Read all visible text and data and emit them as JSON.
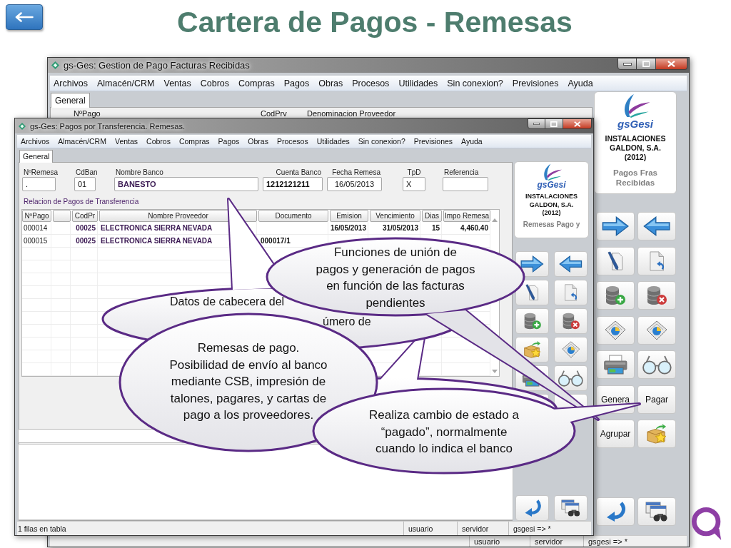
{
  "slide": {
    "title": "Cartera de Pagos - Remesas"
  },
  "back_window": {
    "title": "gs-Ges: Gestion de Pago Facturas Recibidas",
    "menu": [
      "Archivos",
      "Almacén/CRM",
      "Ventas",
      "Cobros",
      "Compras",
      "Pagos",
      "Obras",
      "Procesos",
      "Utilidades",
      "Sin conexion?",
      "Previsiones",
      "Ayuda"
    ],
    "tabs": [
      {
        "label": "General",
        "selected": true
      }
    ],
    "header_labels": [
      "NºPago",
      "CodPrv",
      "Denominacion Proveedor"
    ],
    "side_panel": {
      "brand": "gsGesi",
      "company": [
        "INSTALACIONES",
        "GALDON, S.A.",
        "(2012)"
      ],
      "module": "Pagos Fras Recibidas",
      "buttons": [
        "Genera",
        "Pagar",
        "Agrupar"
      ]
    },
    "status_bar": [
      "usuario",
      "servidor",
      "gsgesi => *"
    ]
  },
  "front_window": {
    "title": "gs-Ges: Pagos por Transferencia. Remesas.",
    "menu": [
      "Archivos",
      "Almacén/CRM",
      "Ventas",
      "Cobros",
      "Compras",
      "Pagos",
      "Obras",
      "Procesos",
      "Utilidades",
      "Sin conexion?",
      "Previsiones",
      "Ayuda"
    ],
    "tabs": [
      {
        "label": "General",
        "selected": true
      }
    ],
    "fields": [
      {
        "label": "NºRemesa",
        "value": "."
      },
      {
        "label": "CdBan",
        "value": "01"
      },
      {
        "label": "Nombre Banco",
        "value": "BANESTO"
      },
      {
        "label": "Cuenta Banco",
        "value": "1212121211"
      },
      {
        "label": "Fecha Remesa",
        "value": "16/05/2013"
      },
      {
        "label": "TpD",
        "value": "X"
      },
      {
        "label": "Referencia"
      }
    ],
    "section_title": "Relacion de Pagos de Transferencia",
    "table": {
      "columns": {
        "n_pago": "NºPago",
        "cod_pr": "CodPr",
        "nombre_proveedor": "Nombre Proveedor",
        "documento": "Documento",
        "emision": "Emision",
        "vencimiento": "Vencimiento",
        "dias": "Dias",
        "impo_remesa": "Impo Remesa"
      },
      "rows": [
        {
          "n_pago": "000014",
          "cod_pr": "00025",
          "nombre_proveedor": "ELECTRONICA SIERRA NEVADA",
          "emision": "16/05/2013",
          "vencimiento": "31/05/2013",
          "dias": "15",
          "impo_remesa": "4,460.40"
        },
        {
          "n_pago": "000015",
          "cod_pr": "00025",
          "nombre_proveedor": "ELECTRONICA SIERRA NEVADA",
          "documento": "000017/1"
        }
      ]
    },
    "side_panel": {
      "brand": "gsGesi",
      "company": [
        "INSTALACIONES",
        "GALDON, S.A.",
        "(2012)"
      ],
      "module": "Remesas Pago y"
    },
    "status_bar": [
      "1 filas en tabla",
      "usuario",
      "servidor",
      "gsgesi => *"
    ]
  },
  "callouts": [
    {
      "fragments": [
        "Datos de cabecera del",
        "úmero de"
      ]
    },
    {
      "lines": [
        "Funciones de unión de",
        "pagos y generación de pagos",
        "en función de las facturas",
        "pendientes"
      ]
    },
    {
      "lines": [
        "Remesas de pago.",
        "Posibilidad de envío al banco",
        "mediante CSB, impresión de",
        "talones, pagares, y cartas de",
        "pago a los proveedores."
      ]
    },
    {
      "lines": [
        "Realiza cambio de estado a",
        "“pagado”, normalmente",
        "cuando lo indica el banco"
      ]
    }
  ]
}
